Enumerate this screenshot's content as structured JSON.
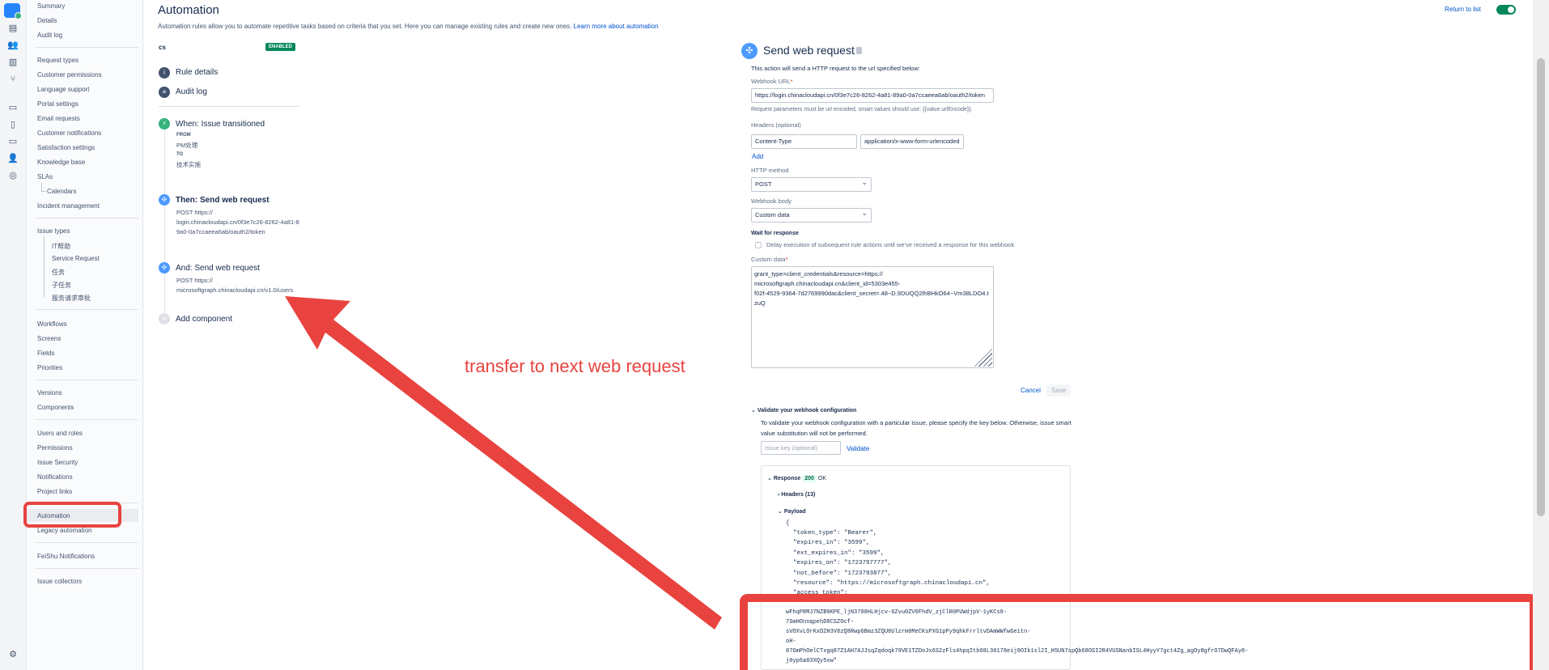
{
  "colors": {
    "accent": "#0052cc",
    "enabled": "#00875a",
    "annotation": "#e8433f",
    "step_icon": "#4c9aff",
    "trigger_icon": "#36b37e"
  },
  "rail_icons": [
    "jira-logo-icon",
    "board-icon",
    "people-icon",
    "chart-icon",
    "tree-icon",
    "queue-icon",
    "page-icon",
    "monitor-icon",
    "user-settings-icon",
    "compass-icon",
    "gear-icon"
  ],
  "sidebar": {
    "items": [
      "Summary",
      "Details",
      "Audit log",
      "Request types",
      "Customer permissions",
      "Language support",
      "Portal settings",
      "Email requests",
      "Customer notifications",
      "Satisfaction settings",
      "Knowledge base",
      "SLAs",
      "Calendars",
      "Incident management",
      "Issue types",
      "IT帮助",
      "Service Request",
      "任务",
      "子任务",
      "服务请求审批",
      "Workflows",
      "Screens",
      "Fields",
      "Priorities",
      "Versions",
      "Components",
      "Users and roles",
      "Permissions",
      "Issue Security",
      "Notifications",
      "Project links",
      "Automation",
      "Legacy automation",
      "FeiShu Notifications",
      "Issue collectors"
    ],
    "active": "Automation"
  },
  "header": {
    "title": "Automation",
    "intro": "Automation rules allow you to automate repetitive tasks based on criteria that you set. Here you can manage existing rules and create new ones. ",
    "learn_more": "Learn more about automation",
    "return_link": "Return to list"
  },
  "rule": {
    "name": "cs",
    "status": "ENABLED",
    "nav": [
      "Rule details",
      "Audit log"
    ],
    "trigger": {
      "title": "When: Issue transitioned",
      "from_label": "FROM",
      "from": "PM处理",
      "to_label": "TO",
      "to": "技术实施"
    },
    "action1": {
      "title": "Then: Send web request",
      "lines": [
        "POST https://",
        "login.chinacloudapi.cn/0f3e7c26-8262-4a81-8",
        "9a0-0a7ccaeea6ab/oauth2/token"
      ]
    },
    "action2": {
      "title": "And: Send web request",
      "lines": [
        "POST https://",
        "microsoftgraph.chinacloudapi.cn/v1.0/users"
      ]
    },
    "add": "Add component"
  },
  "annotation": "transfer to next web request",
  "panel": {
    "title": "Send web request",
    "description": "This action will send a HTTP request to the url specified below:",
    "url_label": "Webhook URL",
    "url_value": "https://login.chinacloudapi.cn/0f3e7c26-8262-4a81-89a0-0a7ccaeea6ab/oauth2/token",
    "url_hint": "Request parameters must be url encoded, smart values should use: {{value.urlEncode}}.",
    "headers_label": "Headers (optional)",
    "header_key": "Content-Type",
    "header_value": "application/x-www-form-urlencoded",
    "add_link": "Add",
    "method_label": "HTTP method",
    "method_value": "POST",
    "body_label": "Webhook body",
    "body_value": "Custom data",
    "wait_label": "Wait for response",
    "wait_text": "Delay execution of subsequent rule actions until we've received a response for this webhook",
    "custom_label": "Custom data",
    "custom_data": "grant_type=client_credentials&resource=https://\nmicrosoftgraph.chinacloudapi.cn&client_id=5303e455-\nf02f-4529-9364-7d2769990dac&client_secret=.48~D.9DUQQ2lhBHkO64~Vm38LDO4.t\nzuQ",
    "cancel": "Cancel",
    "save": "Save",
    "validate_title": "Validate your webhook configuration",
    "validate_text_1": "To validate your webhook configuration with a particular issue, please specify the key below. Otherwise, issue smart",
    "validate_text_2": "value substitution will not be performed.",
    "issue_key_placeholder": "Issue key (optional)",
    "validate_link": "Validate",
    "response": {
      "label": "Response",
      "code": "200",
      "status": "OK",
      "headers": "Headers (13)",
      "payload": "Payload",
      "lines": [
        "{",
        "  \"token_type\": \"Bearer\",",
        "  \"expires_in\": \"3599\",",
        "  \"ext_expires_in\": \"3599\",",
        "  \"expires_on\": \"1723797777\",",
        "  \"not_before\": \"1723793877\",",
        "  \"resource\": \"https://microsoftgraph.chinacloudapi.cn\",",
        "  \"access_token\":"
      ],
      "token_lines": [
        "wFhqPRMJ7NZB9KPE_ljN3798HLHjcv-6Zvu0ZV0FhdV_zjClR0PUWdjpV-1yKCs8-",
        "7SmHOnnqpehD8CSZOcf-",
        "sVOXvLOrKxDZH3V8zQ8Rwp6Bmz3ZQU8Ulzrm0MeCKsPXG1pPy9qhkFrrltvDAmWWfwGeitn-",
        "oH-",
        "87GmPhOelCTxgq87Z1AH7AJJsqZqdoqk79VE1TZDoJx6S2zFls4hpqItb68L30178eij9OIk1sl2I_H5UN7spQb68OSI2R4VUSNanbISL4HyyY7gct4Zg_agOy8gfrO7DwQFAy8-",
        "j0yp6a83XQy5xw\""
      ]
    }
  }
}
